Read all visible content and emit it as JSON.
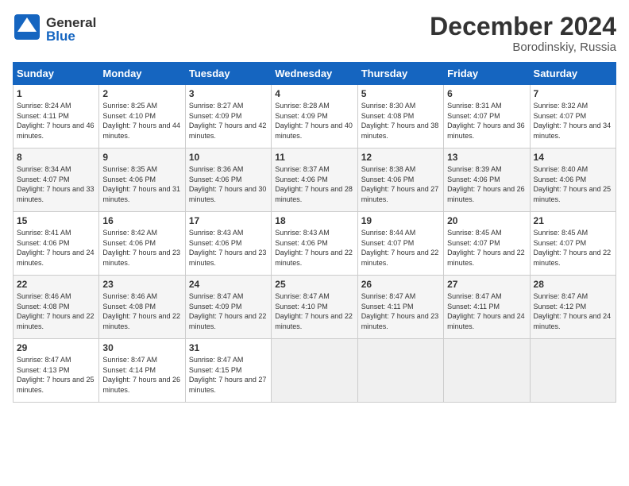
{
  "header": {
    "logo_general": "General",
    "logo_blue": "Blue",
    "month_title": "December 2024",
    "location": "Borodinskiy, Russia"
  },
  "days_of_week": [
    "Sunday",
    "Monday",
    "Tuesday",
    "Wednesday",
    "Thursday",
    "Friday",
    "Saturday"
  ],
  "weeks": [
    [
      {
        "day": "1",
        "sunrise": "Sunrise: 8:24 AM",
        "sunset": "Sunset: 4:11 PM",
        "daylight": "Daylight: 7 hours and 46 minutes."
      },
      {
        "day": "2",
        "sunrise": "Sunrise: 8:25 AM",
        "sunset": "Sunset: 4:10 PM",
        "daylight": "Daylight: 7 hours and 44 minutes."
      },
      {
        "day": "3",
        "sunrise": "Sunrise: 8:27 AM",
        "sunset": "Sunset: 4:09 PM",
        "daylight": "Daylight: 7 hours and 42 minutes."
      },
      {
        "day": "4",
        "sunrise": "Sunrise: 8:28 AM",
        "sunset": "Sunset: 4:09 PM",
        "daylight": "Daylight: 7 hours and 40 minutes."
      },
      {
        "day": "5",
        "sunrise": "Sunrise: 8:30 AM",
        "sunset": "Sunset: 4:08 PM",
        "daylight": "Daylight: 7 hours and 38 minutes."
      },
      {
        "day": "6",
        "sunrise": "Sunrise: 8:31 AM",
        "sunset": "Sunset: 4:07 PM",
        "daylight": "Daylight: 7 hours and 36 minutes."
      },
      {
        "day": "7",
        "sunrise": "Sunrise: 8:32 AM",
        "sunset": "Sunset: 4:07 PM",
        "daylight": "Daylight: 7 hours and 34 minutes."
      }
    ],
    [
      {
        "day": "8",
        "sunrise": "Sunrise: 8:34 AM",
        "sunset": "Sunset: 4:07 PM",
        "daylight": "Daylight: 7 hours and 33 minutes."
      },
      {
        "day": "9",
        "sunrise": "Sunrise: 8:35 AM",
        "sunset": "Sunset: 4:06 PM",
        "daylight": "Daylight: 7 hours and 31 minutes."
      },
      {
        "day": "10",
        "sunrise": "Sunrise: 8:36 AM",
        "sunset": "Sunset: 4:06 PM",
        "daylight": "Daylight: 7 hours and 30 minutes."
      },
      {
        "day": "11",
        "sunrise": "Sunrise: 8:37 AM",
        "sunset": "Sunset: 4:06 PM",
        "daylight": "Daylight: 7 hours and 28 minutes."
      },
      {
        "day": "12",
        "sunrise": "Sunrise: 8:38 AM",
        "sunset": "Sunset: 4:06 PM",
        "daylight": "Daylight: 7 hours and 27 minutes."
      },
      {
        "day": "13",
        "sunrise": "Sunrise: 8:39 AM",
        "sunset": "Sunset: 4:06 PM",
        "daylight": "Daylight: 7 hours and 26 minutes."
      },
      {
        "day": "14",
        "sunrise": "Sunrise: 8:40 AM",
        "sunset": "Sunset: 4:06 PM",
        "daylight": "Daylight: 7 hours and 25 minutes."
      }
    ],
    [
      {
        "day": "15",
        "sunrise": "Sunrise: 8:41 AM",
        "sunset": "Sunset: 4:06 PM",
        "daylight": "Daylight: 7 hours and 24 minutes."
      },
      {
        "day": "16",
        "sunrise": "Sunrise: 8:42 AM",
        "sunset": "Sunset: 4:06 PM",
        "daylight": "Daylight: 7 hours and 23 minutes."
      },
      {
        "day": "17",
        "sunrise": "Sunrise: 8:43 AM",
        "sunset": "Sunset: 4:06 PM",
        "daylight": "Daylight: 7 hours and 23 minutes."
      },
      {
        "day": "18",
        "sunrise": "Sunrise: 8:43 AM",
        "sunset": "Sunset: 4:06 PM",
        "daylight": "Daylight: 7 hours and 22 minutes."
      },
      {
        "day": "19",
        "sunrise": "Sunrise: 8:44 AM",
        "sunset": "Sunset: 4:07 PM",
        "daylight": "Daylight: 7 hours and 22 minutes."
      },
      {
        "day": "20",
        "sunrise": "Sunrise: 8:45 AM",
        "sunset": "Sunset: 4:07 PM",
        "daylight": "Daylight: 7 hours and 22 minutes."
      },
      {
        "day": "21",
        "sunrise": "Sunrise: 8:45 AM",
        "sunset": "Sunset: 4:07 PM",
        "daylight": "Daylight: 7 hours and 22 minutes."
      }
    ],
    [
      {
        "day": "22",
        "sunrise": "Sunrise: 8:46 AM",
        "sunset": "Sunset: 4:08 PM",
        "daylight": "Daylight: 7 hours and 22 minutes."
      },
      {
        "day": "23",
        "sunrise": "Sunrise: 8:46 AM",
        "sunset": "Sunset: 4:08 PM",
        "daylight": "Daylight: 7 hours and 22 minutes."
      },
      {
        "day": "24",
        "sunrise": "Sunrise: 8:47 AM",
        "sunset": "Sunset: 4:09 PM",
        "daylight": "Daylight: 7 hours and 22 minutes."
      },
      {
        "day": "25",
        "sunrise": "Sunrise: 8:47 AM",
        "sunset": "Sunset: 4:10 PM",
        "daylight": "Daylight: 7 hours and 22 minutes."
      },
      {
        "day": "26",
        "sunrise": "Sunrise: 8:47 AM",
        "sunset": "Sunset: 4:11 PM",
        "daylight": "Daylight: 7 hours and 23 minutes."
      },
      {
        "day": "27",
        "sunrise": "Sunrise: 8:47 AM",
        "sunset": "Sunset: 4:11 PM",
        "daylight": "Daylight: 7 hours and 24 minutes."
      },
      {
        "day": "28",
        "sunrise": "Sunrise: 8:47 AM",
        "sunset": "Sunset: 4:12 PM",
        "daylight": "Daylight: 7 hours and 24 minutes."
      }
    ],
    [
      {
        "day": "29",
        "sunrise": "Sunrise: 8:47 AM",
        "sunset": "Sunset: 4:13 PM",
        "daylight": "Daylight: 7 hours and 25 minutes."
      },
      {
        "day": "30",
        "sunrise": "Sunrise: 8:47 AM",
        "sunset": "Sunset: 4:14 PM",
        "daylight": "Daylight: 7 hours and 26 minutes."
      },
      {
        "day": "31",
        "sunrise": "Sunrise: 8:47 AM",
        "sunset": "Sunset: 4:15 PM",
        "daylight": "Daylight: 7 hours and 27 minutes."
      },
      null,
      null,
      null,
      null
    ]
  ]
}
